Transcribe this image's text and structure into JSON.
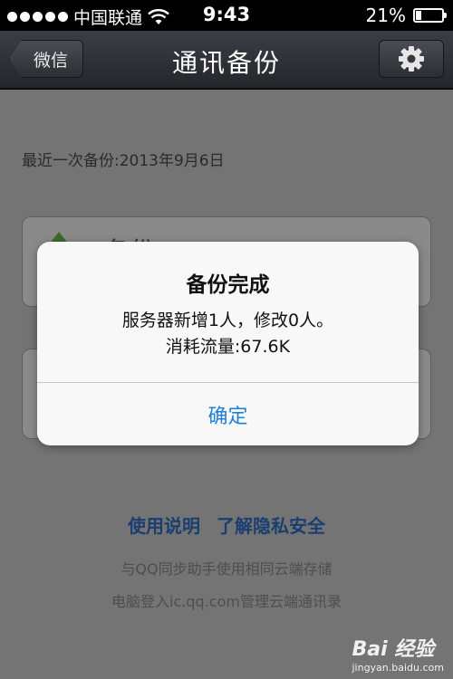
{
  "status_bar": {
    "carrier": "中国联通",
    "time": "9:43",
    "battery_text": "21%",
    "battery_level": 0.21
  },
  "nav": {
    "back_label": "微信",
    "title": "通讯备份",
    "settings_icon": "gear-icon"
  },
  "content": {
    "last_backup": "最近一次备份:2013年9月6日",
    "backup_card_label": "备份",
    "links": [
      "使用说明",
      "了解隐私安全"
    ],
    "info_lines": [
      "与QQ同步助手使用相同云端存储",
      "电脑登入ic.qq.com管理云端通讯录"
    ]
  },
  "alert": {
    "title": "备份完成",
    "message_1": "服务器新增1人，修改0人。",
    "message_2": "消耗流量:67.6K",
    "button_label": "确定"
  },
  "watermark": {
    "brand": "Bai 经验",
    "url": "jingyan.baidu.com"
  },
  "colors": {
    "link": "#1a3e70",
    "alert_button": "#1f7fd6",
    "nav_dark": "#23262b"
  }
}
